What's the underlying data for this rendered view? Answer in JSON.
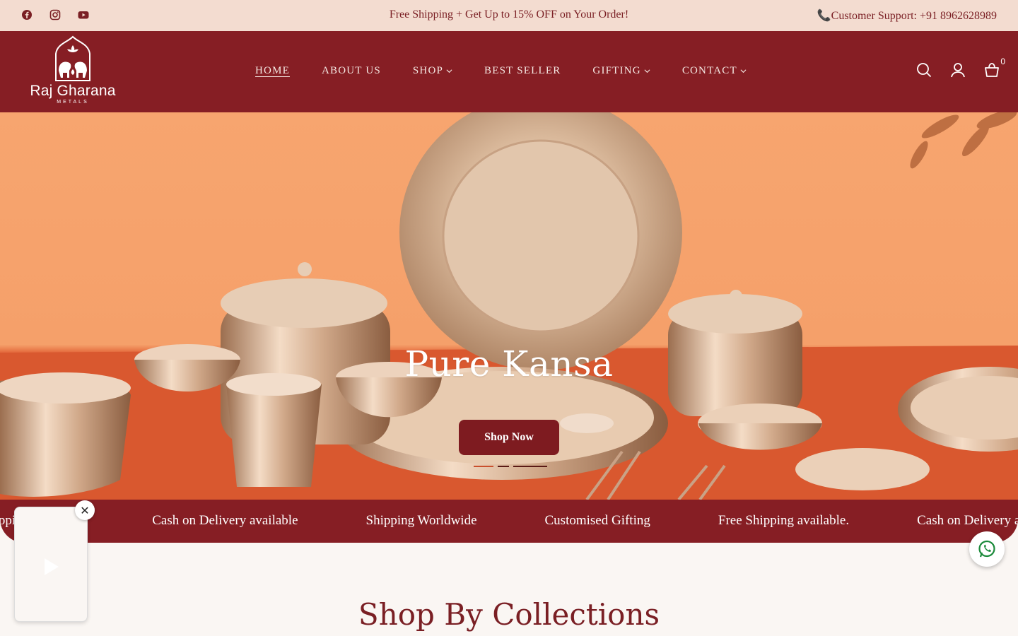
{
  "topbar": {
    "socials": [
      "facebook-icon",
      "instagram-icon",
      "youtube-icon"
    ],
    "promo": "Free Shipping + Get Up to 15% OFF on Your Order!",
    "support": "📞Customer Support: +91 8962628989"
  },
  "header": {
    "brand": "Raj Gharana",
    "brand_sub": "METALS",
    "nav": [
      {
        "label": "HOME",
        "active": true,
        "dropdown": false
      },
      {
        "label": "ABOUT US",
        "active": false,
        "dropdown": false
      },
      {
        "label": "SHOP",
        "active": false,
        "dropdown": true
      },
      {
        "label": "BEST SELLER",
        "active": false,
        "dropdown": false
      },
      {
        "label": "GIFTING",
        "active": false,
        "dropdown": true
      },
      {
        "label": "CONTACT",
        "active": false,
        "dropdown": true
      }
    ],
    "cart_count": "0"
  },
  "hero": {
    "title": "Pure Kansa",
    "cta": "Shop Now"
  },
  "marquee": {
    "items": [
      "Free Shipping available.",
      "Cash on Delivery available",
      "Shipping Worldwide",
      "Customised Gifting",
      "Free Shipping available.",
      "Cash on Delivery available"
    ]
  },
  "collections": {
    "title": "Shop By Collections"
  },
  "colors": {
    "brand": "#861e24",
    "announcement_bg": "#f3dcd0",
    "page_bg": "#faf6f3"
  }
}
